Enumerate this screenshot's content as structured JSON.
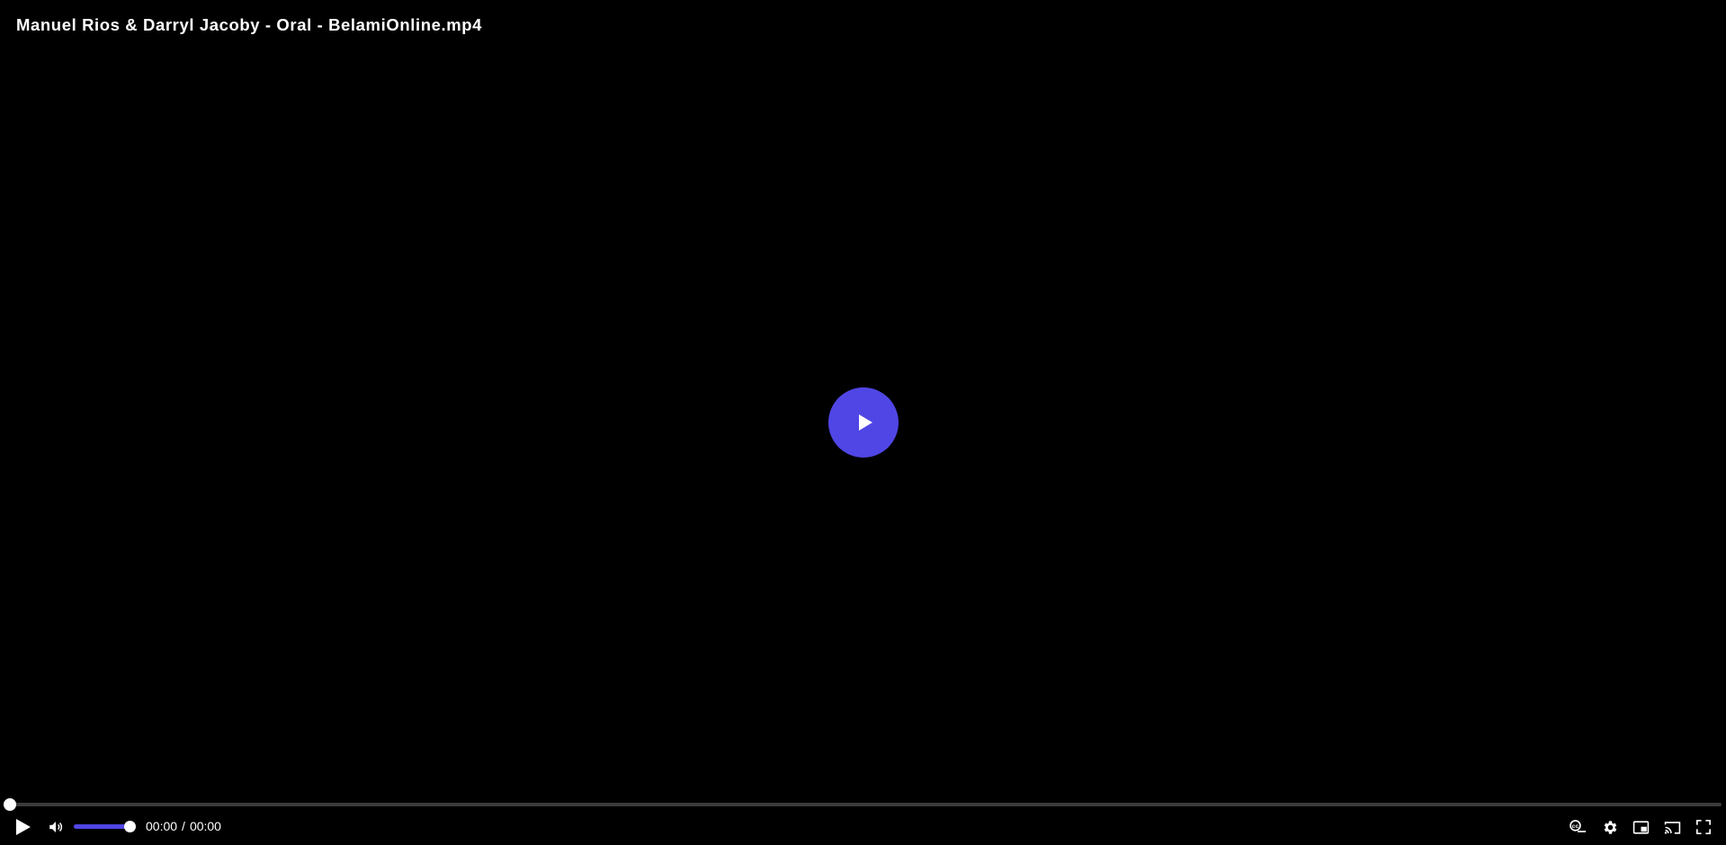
{
  "player": {
    "title": "Manuel Rios & Darryl Jacoby - Oral - BelamiOnline.mp4",
    "accent_color": "#5046e5",
    "current_time": "00:00",
    "time_separator": "/",
    "duration": "00:00",
    "progress_fraction": 0.0,
    "volume_fraction": 1.0
  },
  "icons": {
    "big_play": "play-icon",
    "play": "play-icon",
    "volume": "volume-icon",
    "subtitles": "subtitles-icon",
    "settings": "gear-icon",
    "pip": "picture-in-picture-icon",
    "cast": "cast-icon",
    "fullscreen": "fullscreen-icon"
  }
}
